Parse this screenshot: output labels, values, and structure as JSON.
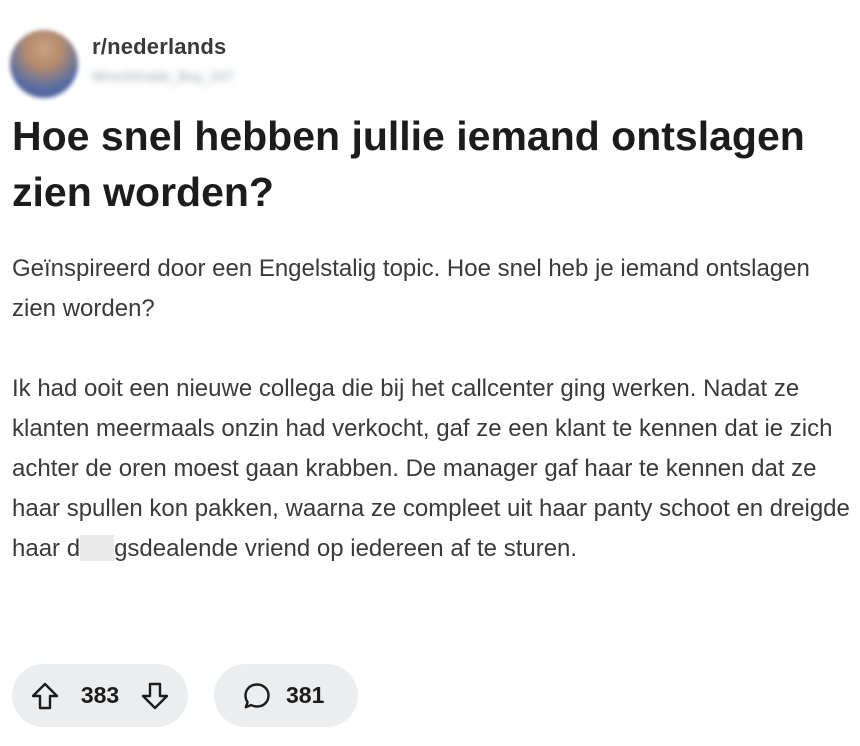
{
  "post": {
    "subreddit": "r/nederlands",
    "username": "Wrochimado_Boy_247",
    "title": "Hoe snel hebben jullie iemand ontslagen zien worden?",
    "body": {
      "p1": "Geïnspireerd door een Engelstalig topic. Hoe snel heb je iemand ontslagen zien worden?",
      "p2_before": "Ik had ooit een nieuwe collega die bij het callcenter ging werken. Nadat ze klanten meermaals onzin had verkocht, gaf ze een klant te kennen dat ie zich achter de oren moest gaan krabben. De manager gaf haar te kennen dat ze haar spullen kon pakken, waarna ze compleet uit haar panty schoot en dreigde haar d",
      "p2_after": "gsdealende vriend op iedereen af te sturen."
    }
  },
  "actions": {
    "upvotes": "383",
    "comments": "381"
  },
  "icons": {
    "upvote": "arrow-up-outline-icon",
    "downvote": "arrow-down-outline-icon",
    "comment": "speech-bubble-icon"
  },
  "colors": {
    "text": "#1c1c1c",
    "body_text": "#3a3a3a",
    "pill_bg": "#ebedef"
  }
}
